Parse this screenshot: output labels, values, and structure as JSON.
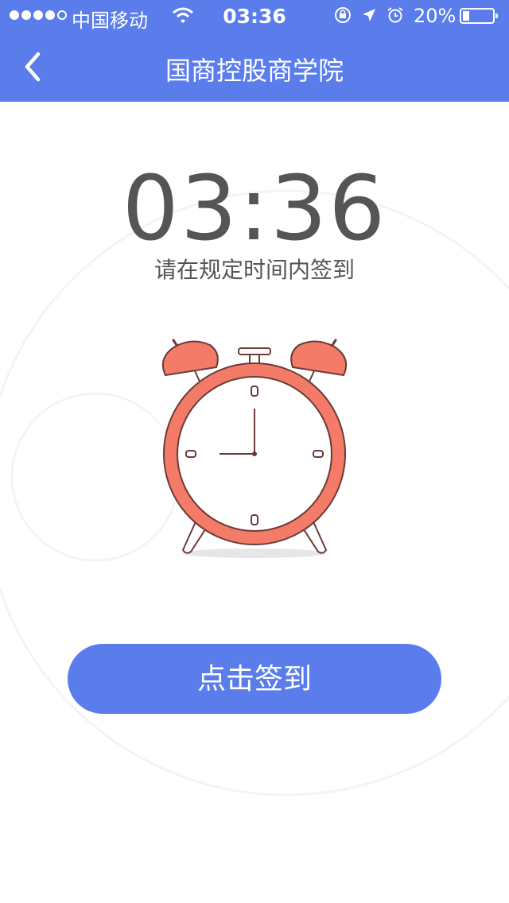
{
  "status_bar": {
    "carrier": "中国移动",
    "time": "03:36",
    "battery": "20%"
  },
  "nav": {
    "title": "国商控股商学院"
  },
  "main": {
    "time_display": "03:36",
    "hint": "请在规定时间内签到",
    "sign_in_button": "点击签到"
  },
  "colors": {
    "brand": "#5A7DEB",
    "alarm": "#F47B67",
    "text": "#555555"
  }
}
